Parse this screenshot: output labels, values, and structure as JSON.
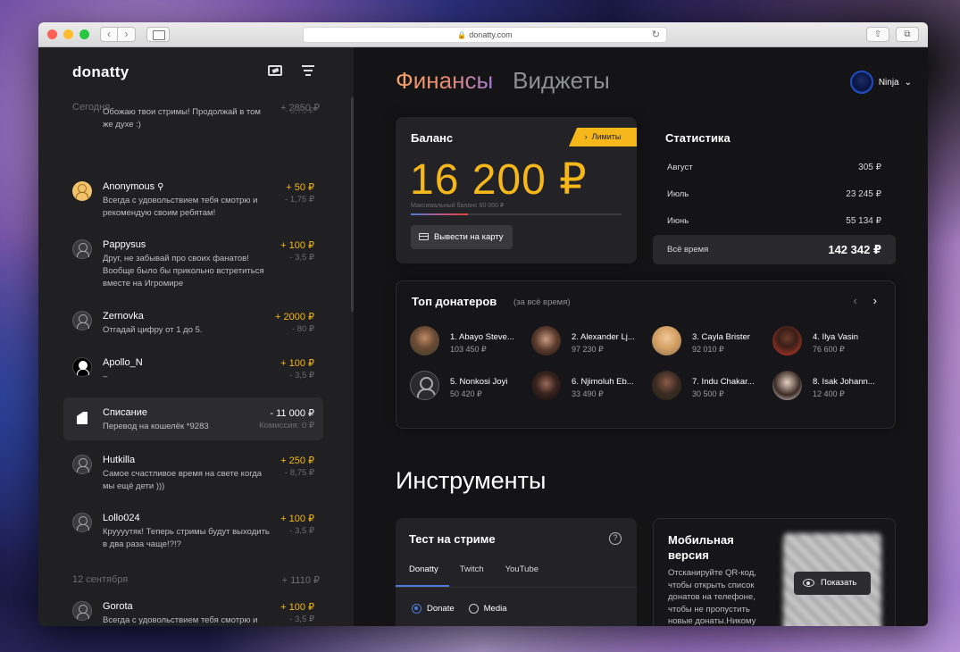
{
  "browser": {
    "url": "donatty.com"
  },
  "sidebar": {
    "logo": "donatty",
    "groups": [
      {
        "label": "Сегодня",
        "total": "+ 2850 ₽"
      },
      {
        "label": "12 сентября",
        "total": "+ 1110 ₽"
      }
    ],
    "partial_item": {
      "msg": "Обожаю твои стримы! Продолжай в том же духе :)",
      "fee": "- 3,75 ₽"
    },
    "items": [
      {
        "name": "Anonymous",
        "msg": "Всегда с удовольствием тебя смотрю и рекомендую своим ребятам!",
        "amount": "+ 50 ₽",
        "fee": "- 1,75 ₽"
      },
      {
        "name": "Pappysus",
        "msg": "Друг, не забывай про своих фанатов! Вообще было бы прикольно встретиться вместе на Игромире",
        "amount": "+ 100 ₽",
        "fee": "- 3,5 ₽"
      },
      {
        "name": "Zernovka",
        "msg": "Отгадай цифру от 1 до 5.",
        "amount": "+ 2000 ₽",
        "fee": "- 80 ₽"
      },
      {
        "name": "Apollo_N",
        "msg": "–",
        "amount": "+ 100 ₽",
        "fee": "- 3,5 ₽"
      },
      {
        "name": "Списание",
        "msg": "Перевод на кошелёк *9283",
        "amount": "- 11 000 ₽",
        "fee": "Комиссия: 0 ₽"
      },
      {
        "name": "Hutkilla",
        "msg": "Самое счастливое время на свете когда мы ещё дети )))",
        "amount": "+ 250 ₽",
        "fee": "- 8,75 ₽"
      },
      {
        "name": "Lollo024",
        "msg": "Круууутяк! Теперь стримы будут выходить в два раза чаще!?!?",
        "amount": "+ 100 ₽",
        "fee": "- 3,5 ₽"
      },
      {
        "name": "Gorota",
        "msg": "Всегда с удовольствием тебя смотрю и рекомендую своим ребятам!",
        "amount": "+ 100 ₽",
        "fee": "- 3,5 ₽"
      }
    ]
  },
  "header": {
    "tab_finance": "Финансы",
    "tab_widgets": "Виджеты",
    "user_name": "Ninja"
  },
  "balance": {
    "title": "Баланс",
    "limits": "Лимиты",
    "amount": "16 200 ₽",
    "max_label": "Максимальный баланс 60 000 ₽",
    "progress": 0.27,
    "withdraw_label": "Вывести на карту"
  },
  "stats": {
    "title": "Статистика",
    "rows": [
      {
        "label": "Август",
        "value": "305 ₽"
      },
      {
        "label": "Июль",
        "value": "23 245 ₽"
      },
      {
        "label": "Июнь",
        "value": "55 134 ₽"
      }
    ],
    "total_label": "Всё время",
    "total_value": "142 342 ₽"
  },
  "top_donors": {
    "title": "Топ донатеров",
    "subtitle": "(за всё время)",
    "donors": [
      {
        "name": "1. Abayo Steve...",
        "sum": "103 450 ₽"
      },
      {
        "name": "2. Alexander Lj...",
        "sum": "97 230 ₽"
      },
      {
        "name": "3. Cayla Brister",
        "sum": "92 010 ₽"
      },
      {
        "name": "4. Ilya Vasin",
        "sum": "76 600 ₽"
      },
      {
        "name": "5. Nonkosi Joyi",
        "sum": "50 420 ₽"
      },
      {
        "name": "6. Njimoluh Eb...",
        "sum": "33 490 ₽"
      },
      {
        "name": "7. Indu Chakar...",
        "sum": "30 500 ₽"
      },
      {
        "name": "8. Isak Johann...",
        "sum": "12 400 ₽"
      }
    ]
  },
  "tools": {
    "title": "Инструменты",
    "stream_test": {
      "title": "Тест на стриме",
      "tabs": [
        "Donatty",
        "Twitch",
        "YouTube"
      ],
      "radios": [
        "Donate",
        "Media"
      ]
    },
    "mobile": {
      "title": "Мобильная версия",
      "desc": "Отсканируйте QR-код, чтобы открыть список донатов на телефоне, чтобы не пропустить новые донаты.Никому",
      "show_label": "Показать"
    }
  }
}
